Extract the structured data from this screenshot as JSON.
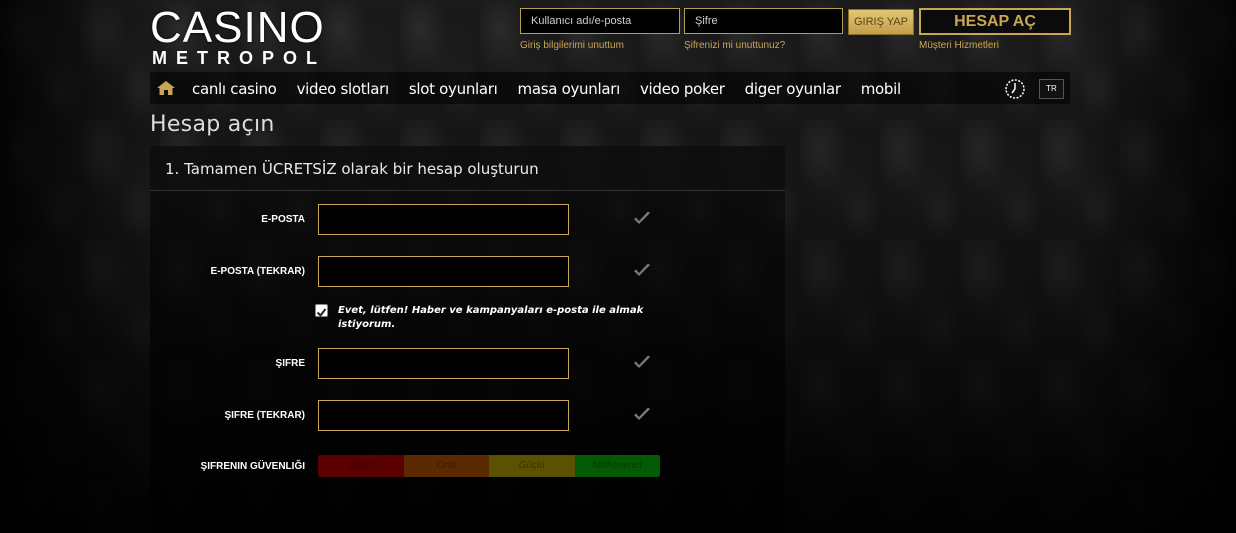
{
  "logo": {
    "top": "CASINO",
    "bottom": "METROPOL"
  },
  "login": {
    "username_placeholder": "Kullanıcı adı/e-posta",
    "password_placeholder": "Şifre",
    "forgot_user": "Giriş bilgilerimi unuttum",
    "forgot_pass": "Şifrenizi mi unuttunuz?",
    "login_button": "GIRIŞ YAP",
    "register_button": "HESAP AÇ",
    "support": "Müşteri Hizmetleri"
  },
  "nav": {
    "items": [
      "canlı casino",
      "video slotları",
      "slot oyunları",
      "masa oyunları",
      "video poker",
      "diger oyunlar",
      "mobil"
    ],
    "lang": "TR",
    "home_icon": "home-icon",
    "clock_icon": "clock-icon"
  },
  "page": {
    "title": "Hesap açın",
    "step_title": "1. Tamamen ÜCRETSİZ olarak bir hesap oluşturun"
  },
  "form": {
    "email_label": "E-POSTA",
    "email_confirm_label": "E-POSTA (TEKRAR)",
    "newsletter_text": "Evet, lütfen! Haber ve kampanyaları e-posta ile almak istiyorum.",
    "newsletter_checked": true,
    "password_label": "ŞIFRE",
    "password_confirm_label": "ŞIFRE (TEKRAR)",
    "strength_label": "ŞIFRENIN GÜVENLIĞI",
    "strength_levels": [
      {
        "label": "Zayıf",
        "bg": "#5a0000",
        "fg": "#3a0000"
      },
      {
        "label": "Orta",
        "bg": "#5c2a00",
        "fg": "#3b1a00"
      },
      {
        "label": "Güçlü",
        "bg": "#5a5200",
        "fg": "#3a3400"
      },
      {
        "label": "Mükemmel",
        "bg": "#045a04",
        "fg": "#023a02"
      }
    ]
  },
  "colors": {
    "gold": "#c9a653",
    "check_gray": "#7a7a7a"
  }
}
